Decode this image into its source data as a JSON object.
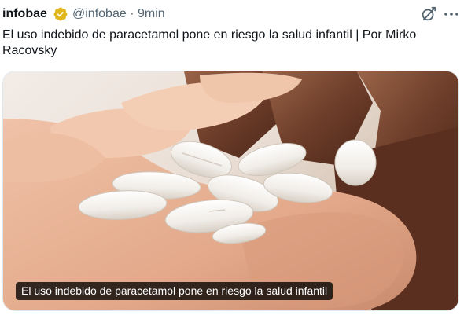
{
  "tweet": {
    "author_name": "infobae",
    "verified_icon": "verified-badge-gold",
    "handle": "@infobae",
    "separator": "·",
    "time_ago": "9min",
    "text": "El uso indebido de paracetamol pone en riesgo la salud infantil | Por Mirko Racovsky",
    "grok_icon": "grok-icon",
    "more_icon": "more-icon",
    "media": {
      "caption": "El uso indebido de paracetamol pone en riesgo la salud infantil",
      "description_icon": "photo-pills-in-hands"
    }
  },
  "colors": {
    "text_primary": "#0f1419",
    "text_secondary": "#536471",
    "verified_gold": "#e2b719"
  }
}
